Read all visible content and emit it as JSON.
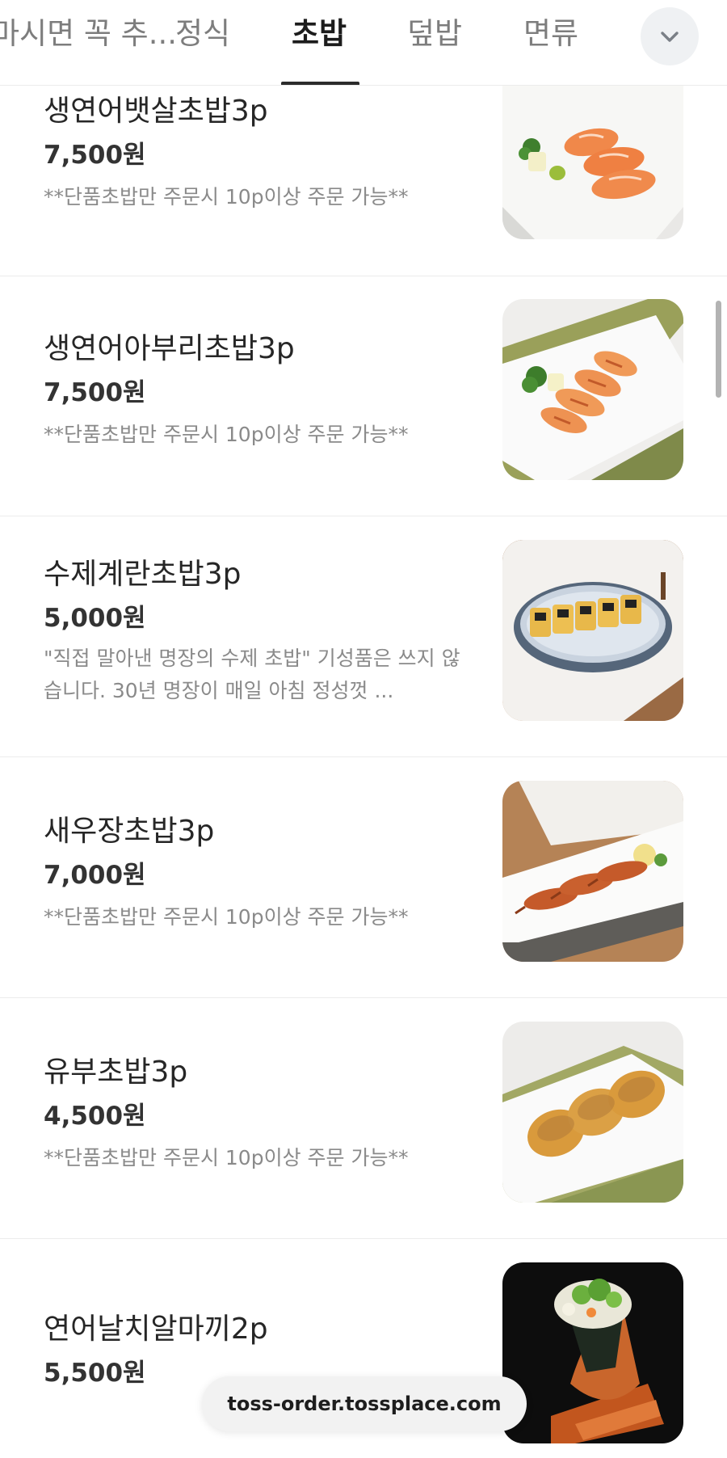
{
  "tabs": [
    {
      "label": "마시면 꼭 추...",
      "active": false
    },
    {
      "label": "정식",
      "active": false
    },
    {
      "label": "초밥",
      "active": true
    },
    {
      "label": "덮밥",
      "active": false
    },
    {
      "label": "면류",
      "active": false
    }
  ],
  "more_button_icon": "chevron-down-icon",
  "menu_items": [
    {
      "name": "생연어뱃살초밥3p",
      "price": "7,500원",
      "desc": "**단품초밥만 주문시 10p이상 주문 가능**",
      "image": "salmon-belly-sushi-photo"
    },
    {
      "name": "생연어아부리초밥3p",
      "price": "7,500원",
      "desc": "**단품초밥만 주문시 10p이상 주문 가능**",
      "image": "seared-salmon-sushi-photo"
    },
    {
      "name": "수제계란초밥3p",
      "price": "5,000원",
      "desc": "\"직접 말아낸 명장의 수제 초밥\" 기성품은 쓰지 않습니다. 30년 명장이 매일 아침 정성껏 ...",
      "image": "egg-sushi-photo"
    },
    {
      "name": "새우장초밥3p",
      "price": "7,000원",
      "desc": "**단품초밥만 주문시 10p이상 주문 가능**",
      "image": "shrimp-sushi-photo"
    },
    {
      "name": "유부초밥3p",
      "price": "4,500원",
      "desc": "**단품초밥만 주문시 10p이상 주문 가능**",
      "image": "inari-sushi-photo"
    },
    {
      "name": "연어날치알마끼2p",
      "price": "5,500원",
      "desc": "",
      "image": "salmon-roe-hand-roll-photo"
    }
  ],
  "url_bar": {
    "text": "toss-order.tossplace.com"
  },
  "colors": {
    "accent": "#1c1c1c",
    "muted_text": "#8a8a8a",
    "divider": "#ececec"
  }
}
